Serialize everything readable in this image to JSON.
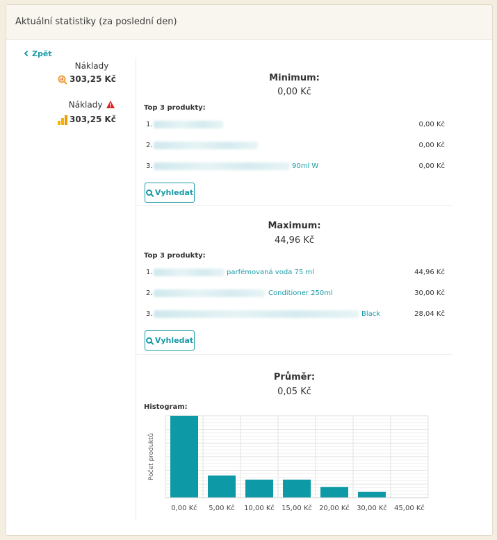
{
  "header": {
    "title": "Aktuální statistiky (za poslední den)"
  },
  "sidebar": {
    "back_label": "Zpět",
    "costs": [
      {
        "label": "Náklady",
        "value": "303,25 Kč",
        "icon": "search-chart-icon",
        "warning": false
      },
      {
        "label": "Náklady",
        "value": "303,25 Kč",
        "icon": "bar-chart-icon",
        "warning": true
      }
    ]
  },
  "minimum": {
    "title": "Minimum:",
    "value": "0,00 Kč",
    "top_label": "Top 3 produkty:",
    "products": [
      {
        "num": "1.",
        "name": "",
        "price": "0,00 Kč"
      },
      {
        "num": "2.",
        "name": "",
        "price": "0,00 Kč"
      },
      {
        "num": "3.",
        "name": "90ml W",
        "price": "0,00 Kč"
      }
    ],
    "search_label": "Vyhledat"
  },
  "maximum": {
    "title": "Maximum:",
    "value": "44,96 Kč",
    "top_label": "Top 3 produkty:",
    "products": [
      {
        "num": "1.",
        "name": "parfémovaná voda 75 ml",
        "price": "44,96 Kč"
      },
      {
        "num": "2.",
        "name": "Conditioner 250ml",
        "price": "30,00 Kč"
      },
      {
        "num": "3.",
        "name": "Black",
        "price": "28,04 Kč"
      }
    ],
    "search_label": "Vyhledat"
  },
  "average": {
    "title": "Průměr:",
    "value": "0,05 Kč",
    "histogram_label": "Histogram:"
  },
  "colors": {
    "accent": "#1a9aa6",
    "bar": "#0d9aa6",
    "background": "#f4eee0",
    "warning": "#e02020"
  },
  "chart_data": {
    "type": "bar",
    "title": "",
    "xlabel": "",
    "ylabel": "Počet produktů",
    "categories": [
      "0,00 Kč",
      "5,00 Kč",
      "10,00 Kč",
      "15,00 Kč",
      "20,00 Kč",
      "30,00 Kč",
      "45,00 Kč"
    ],
    "values": [
      100,
      27,
      22,
      22,
      13,
      7,
      0
    ],
    "ylim": [
      0,
      100
    ],
    "y_ticks_visible": false,
    "grid": true
  }
}
